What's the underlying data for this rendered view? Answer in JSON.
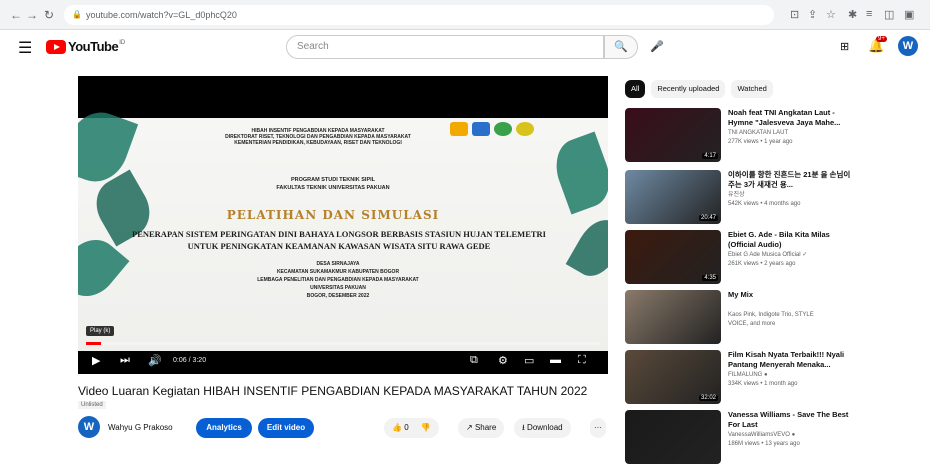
{
  "browser": {
    "url": "youtube.com/watch?v=GL_d0phcQ20"
  },
  "masthead": {
    "logo_text": "YouTube",
    "logo_region": "ID",
    "search_placeholder": "Search",
    "notification_count": "9+",
    "avatar_letter": "W"
  },
  "player": {
    "slide": {
      "header_lines": "HIBAH INSENTIF PENGABDIAN KEPADA MASYARAKAT\nDIREKTORAT RISET, TEKNOLOGI DAN PENGABDIAN KEPADA MASYARAKAT\nKEMENTERIAN PENDIDIKAN, KEBUDAYAAN, RISET DAN TEKNOLOGI",
      "program": "PROGRAM STUDI TEKNIK SIPIL\nFAKULTAS TEKNIK UNIVERSITAS PAKUAN",
      "heading": "PELATIHAN DAN SIMULASI",
      "subtitle": "PENERAPAN SISTEM PERINGATAN DINI BAHAYA LONGSOR BERBASIS STASIUN HUJAN TELEMETRI\nUNTUK PENINGKATAN KEAMANAN KAWASAN WISATA SITU RAWA GEDE",
      "location": "DESA SIRNAJAYA\nKECAMATAN SUKAMAKMUR KABUPATEN BOGOR\nLEMBAGA PENELITIAN DAN PENGABDIAN KEPADA MASYARAKAT\nUNIVERSITAS PAKUAN\nBOGOR, DESEMBER 2022"
    },
    "tooltip": "Play (k)",
    "time": "0:06 / 3:20",
    "progress_fraction": 0.03
  },
  "video": {
    "title": "Video Luaran Kegiatan HIBAH INSENTIF PENGABDIAN KEPADA MASYARAKAT TAHUN 2022",
    "visibility": "Unlisted",
    "channel_avatar": "W",
    "channel_name": "Wahyu G Prakoso",
    "analytics_label": "Analytics",
    "edit_label": "Edit video",
    "like_count": "0",
    "share_label": "Share",
    "download_label": "Download",
    "more_label": "···"
  },
  "sidebar": {
    "chips": [
      "All",
      "Recently uploaded",
      "Watched"
    ],
    "items": [
      {
        "title": "Noah feat TNI Angkatan Laut - Hymne \"Jalesveva Jaya Mahe...",
        "channel": "TNI ANGKATAN LAUT",
        "meta": "277K views • 1 year ago",
        "duration": "4:17",
        "color": "#3a0d1a"
      },
      {
        "title": "이하이를 향한 진흔드는 21분 을 손님이 주는 3가 새재건 용...",
        "channel": "유진상",
        "meta": "542K views • 4 months ago",
        "duration": "20:47",
        "color": "#6f8aa3"
      },
      {
        "title": "Ebiet G. Ade - Bila Kita Milas (Official Audio)",
        "channel": "Ebiet G Ade Musica Official ✓",
        "meta": "261K views • 2 years ago",
        "duration": "4:35",
        "color": "#3c1a0e"
      },
      {
        "title": "My Mix",
        "channel": "Kaos Pink, Indigote Trio, STYLE",
        "meta": "VOICE, and more",
        "duration": "",
        "color": "#8a7a6a"
      },
      {
        "title": "Film Kisah Nyata Terbaik!!! Nyali Pantang Menyerah Menaka...",
        "channel": "FILMALUNG ●",
        "meta": "334K views • 1 month ago",
        "duration": "32:02",
        "color": "#5a4a3a"
      },
      {
        "title": "Vanessa Williams - Save The Best For Last",
        "channel": "VanessaWilliamsVEVO ●",
        "meta": "186M views • 13 years ago",
        "duration": "",
        "color": "#1a1a1a"
      }
    ]
  }
}
